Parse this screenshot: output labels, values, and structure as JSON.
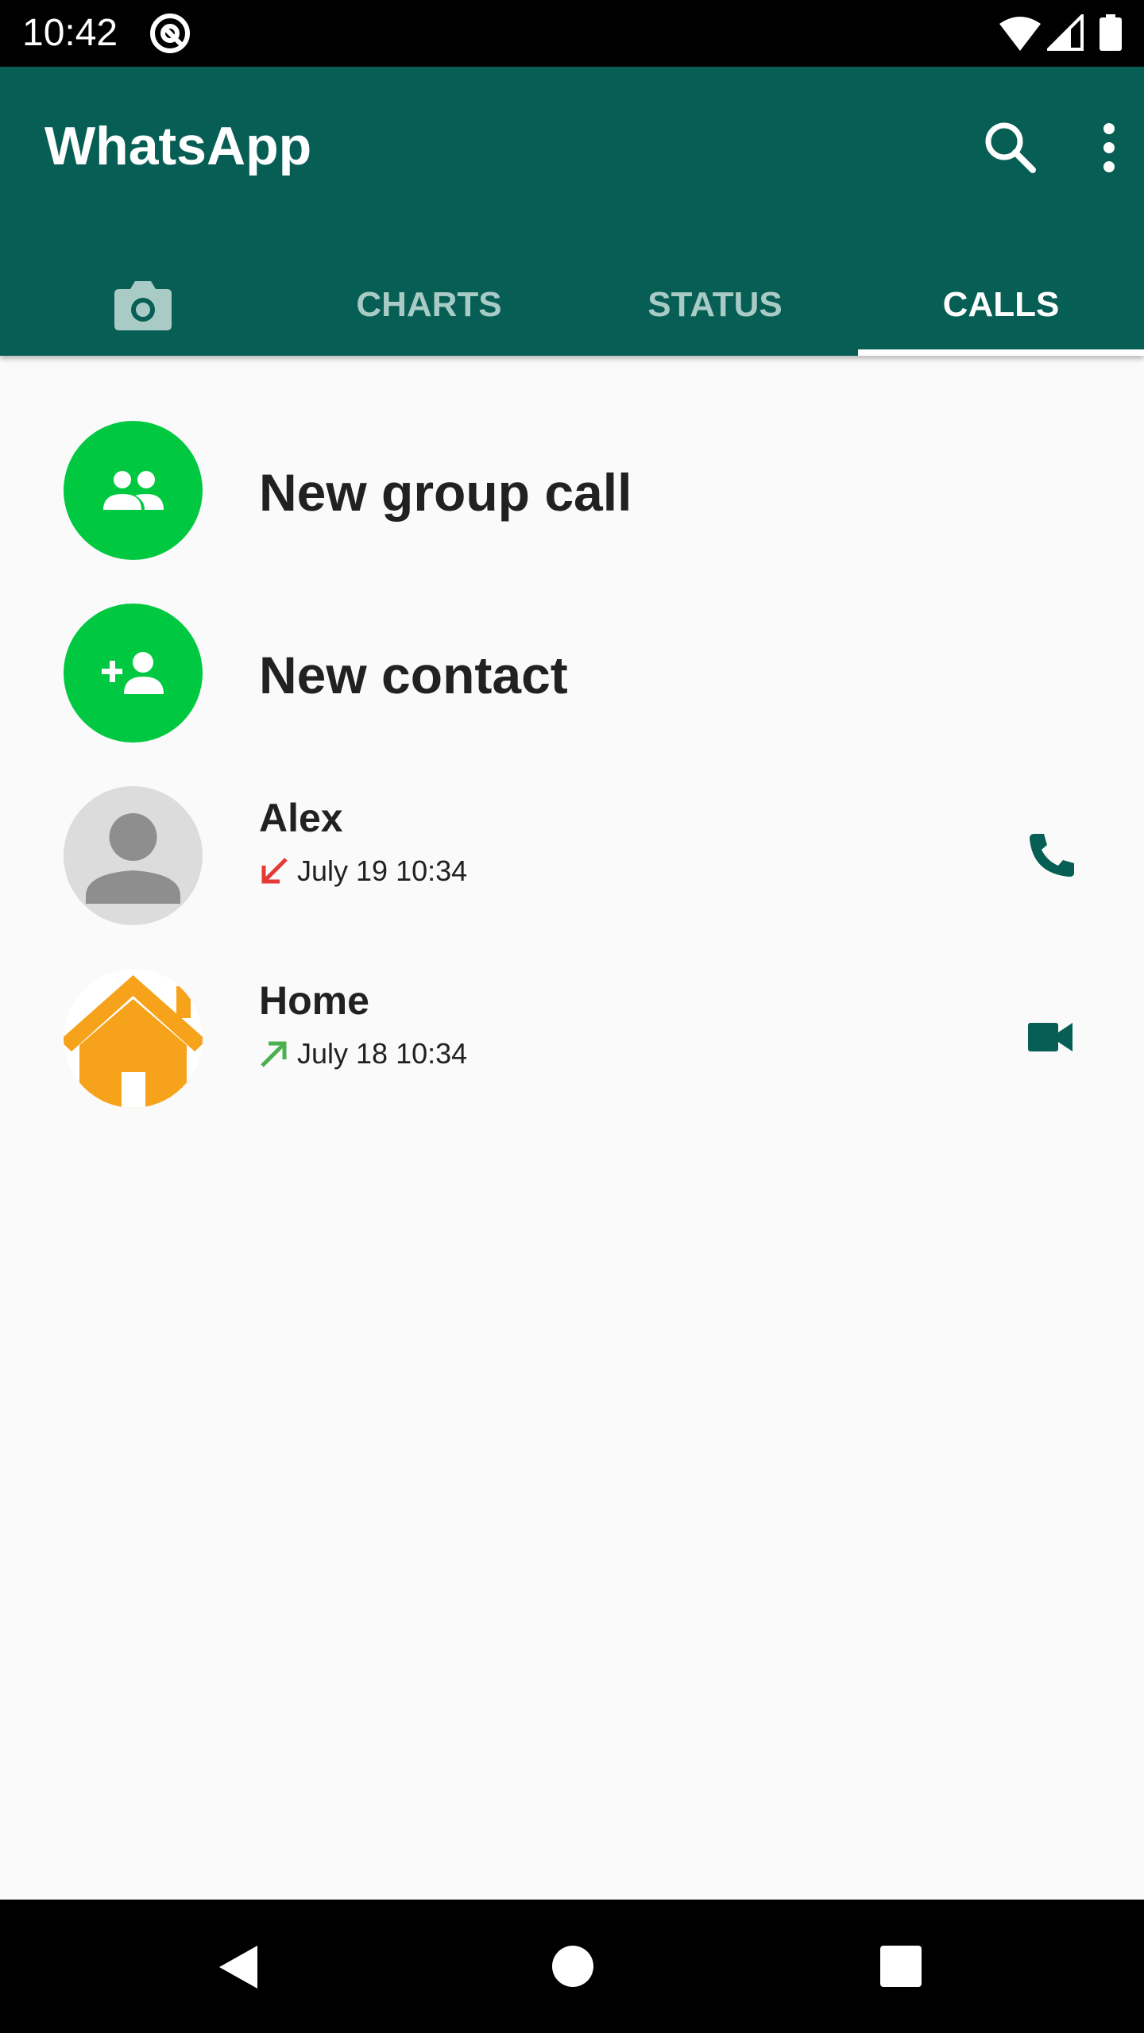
{
  "status_bar": {
    "time": "10:42",
    "icons": [
      "at-sign-icon",
      "wifi-icon",
      "signal-icon",
      "battery-icon"
    ]
  },
  "app_bar": {
    "title": "WhatsApp",
    "actions": [
      "search-icon",
      "more-vert-icon"
    ],
    "background_color": "#075e54"
  },
  "tabs": [
    {
      "icon": "camera-icon",
      "label": ""
    },
    {
      "label": "CHARTS"
    },
    {
      "label": "STATUS"
    },
    {
      "label": "CALLS",
      "active": true
    }
  ],
  "list": {
    "actions": [
      {
        "icon": "group-icon",
        "label": "New group call"
      },
      {
        "icon": "add-contact-icon",
        "label": "New contact"
      }
    ],
    "calls": [
      {
        "name": "Alex",
        "direction": "missed-incoming",
        "date": "July 19 10:34",
        "avatar": "person-placeholder",
        "action_icon": "phone-icon"
      },
      {
        "name": "Home",
        "direction": "outgoing",
        "date": "July 18 10:34",
        "avatar": "house-icon",
        "action_icon": "video-call-icon"
      }
    ]
  },
  "colors": {
    "accent_green": "#00c941",
    "missed_red": "#e53935",
    "outgoing_green": "#4caf50",
    "icon_teal": "#075e54",
    "house_orange": "#f7a21b"
  }
}
